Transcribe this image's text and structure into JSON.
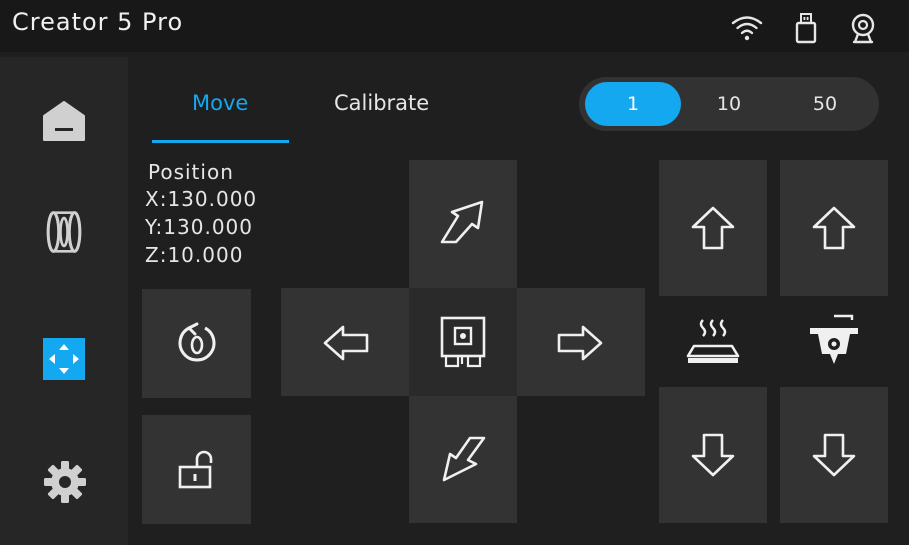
{
  "header": {
    "title": "Creator 5 Pro"
  },
  "status_icons": [
    "wifi-icon",
    "usb-drive-icon",
    "webcam-icon"
  ],
  "sidebar": {
    "items": [
      {
        "name": "home",
        "icon": "home-icon",
        "active": false
      },
      {
        "name": "filament",
        "icon": "filament-spool-icon",
        "active": false
      },
      {
        "name": "move",
        "icon": "move-axis-icon",
        "active": true
      },
      {
        "name": "settings",
        "icon": "gear-icon",
        "active": false
      }
    ]
  },
  "tabs": [
    {
      "label": "Move",
      "active": true
    },
    {
      "label": "Calibrate",
      "active": false
    }
  ],
  "step_sizes": {
    "options": [
      "1",
      "10",
      "50"
    ],
    "selected": "1"
  },
  "position": {
    "heading": "Position",
    "x": "X:130.000",
    "y": "Y:130.000",
    "z": "Z:10.000"
  },
  "controls": {
    "home_axes_icon": "home-axes-icon",
    "unlock_motors_icon": "unlock-icon",
    "y_plus_icon": "arrow-up-right-icon",
    "y_minus_icon": "arrow-down-left-icon",
    "x_minus_icon": "arrow-left-icon",
    "x_plus_icon": "arrow-right-icon",
    "center_icon": "print-head-icon",
    "bed_up_icon": "arrow-up-icon",
    "bed_down_icon": "arrow-down-icon",
    "nozzle_up_icon": "arrow-up-icon",
    "nozzle_down_icon": "arrow-down-icon",
    "bed_label_icon": "heated-bed-icon",
    "nozzle_label_icon": "extruder-icon"
  },
  "colors": {
    "accent": "#13a8f0",
    "tile": "#333333",
    "background": "#1f1f1f",
    "sidebar": "#262626"
  }
}
